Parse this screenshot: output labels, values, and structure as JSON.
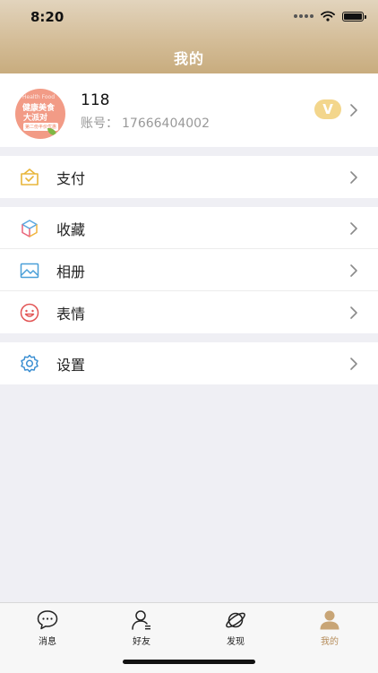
{
  "status": {
    "time": "8:20"
  },
  "nav": {
    "title": "我的"
  },
  "profile": {
    "name": "118",
    "account_label": "账号：",
    "account_number": "17666404002",
    "vip": "V",
    "avatar_text": {
      "sub": "Health Food",
      "line1": "健康美食",
      "line2": "大派对",
      "tag": "第二份半价优惠"
    }
  },
  "menu": {
    "pay": {
      "label": "支付",
      "icon": "wallet-icon"
    },
    "favorites": {
      "label": "收藏",
      "icon": "cube-icon"
    },
    "album": {
      "label": "相册",
      "icon": "image-icon"
    },
    "emoji": {
      "label": "表情",
      "icon": "smile-icon"
    },
    "settings": {
      "label": "设置",
      "icon": "gear-icon"
    }
  },
  "tabbar": {
    "messages": "消息",
    "friends": "好友",
    "discover": "发现",
    "me": "我的"
  },
  "colors": {
    "accent": "#b58c5a",
    "nav_gradient_top": "#e2d4bd",
    "nav_gradient_bottom": "#c8ac7e",
    "vip_badge": "#f3d68c"
  }
}
